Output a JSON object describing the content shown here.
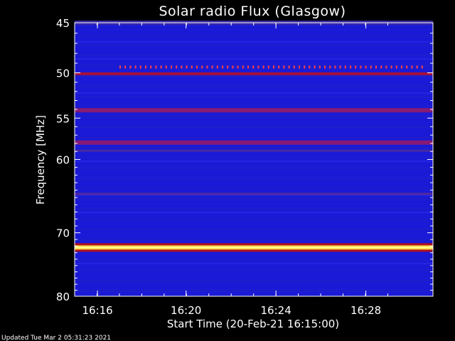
{
  "chart_data": {
    "type": "heatmap",
    "title": "Solar radio Flux (Glasgow)",
    "xlabel": "Start Time (20-Feb-21 16:15:00)",
    "ylabel": "Frequency [MHz]",
    "x_range_minutes": [
      16.25,
      16.517
    ],
    "x_ticks": [
      {
        "label": "16:16",
        "minutes": 16.267
      },
      {
        "label": "16:20",
        "minutes": 16.333
      },
      {
        "label": "16:24",
        "minutes": 16.4
      },
      {
        "label": "16:28",
        "minutes": 16.467
      }
    ],
    "y_scale": "log",
    "y_range": [
      45,
      80
    ],
    "y_ticks": [
      45,
      50,
      55,
      60,
      70,
      80
    ],
    "y_tick_labels": [
      "45",
      "50",
      "55",
      "60",
      "70",
      "80"
    ],
    "background_color": "#1a1ad8",
    "bands": [
      {
        "freq_mhz": 45.0,
        "intensity": "medium",
        "color": "#3a2aa8"
      },
      {
        "freq_mhz": 50.1,
        "intensity": "high",
        "color": "#b01030"
      },
      {
        "freq_mhz": 54.1,
        "intensity": "medium",
        "color": "#8c1a70"
      },
      {
        "freq_mhz": 57.9,
        "intensity": "medium",
        "color": "#8c1a70"
      },
      {
        "freq_mhz": 58.9,
        "intensity": "low",
        "color": "#4a2aa0"
      },
      {
        "freq_mhz": 64.5,
        "intensity": "low",
        "color": "#5a2a9c"
      },
      {
        "freq_mhz": 72.2,
        "intensity": "very-high",
        "color": "#ffff90"
      }
    ],
    "spikes_freq_mhz": 49.4,
    "colors": {
      "background": "#000000",
      "axis": "#ffffff",
      "strong_band": "#ffff90"
    }
  },
  "footer": {
    "updated": "Updated Tue Mar  2 05:31:23 2021"
  }
}
